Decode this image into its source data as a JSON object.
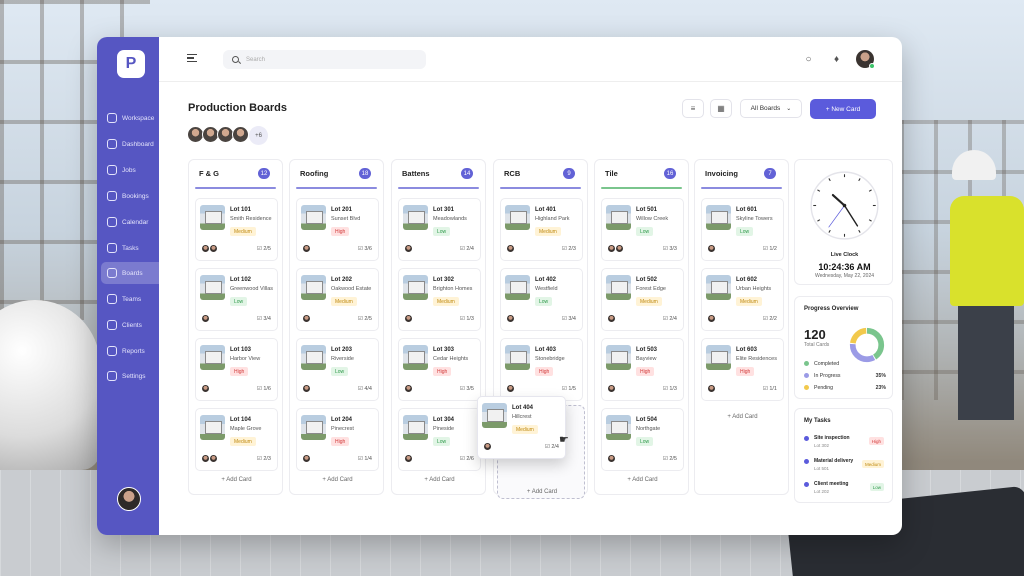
{
  "sidebar": {
    "items": [
      {
        "label": "Workspace"
      },
      {
        "label": "Dashboard"
      },
      {
        "label": "Jobs"
      },
      {
        "label": "Bookings"
      },
      {
        "label": "Calendar"
      },
      {
        "label": "Tasks"
      },
      {
        "label": "Boards"
      },
      {
        "label": "Teams"
      },
      {
        "label": "Clients"
      },
      {
        "label": "Reports"
      },
      {
        "label": "Settings"
      }
    ],
    "active": "Boards"
  },
  "topbar": {
    "search_placeholder": "Search"
  },
  "page": {
    "title": "Production Boards",
    "extra_members": "+6",
    "filter_label": "All Boards",
    "new_card_label": "+ New Card"
  },
  "columns": [
    {
      "name": "F & G",
      "count": "12",
      "color": "#8b8bdf",
      "cards": [
        {
          "lot": "Lot 101",
          "name": "Smith Residence",
          "priority": "Medium",
          "tasks": "2/5",
          "avatars": 2
        },
        {
          "lot": "Lot 102",
          "name": "Greenwood Villas",
          "priority": "Low",
          "tasks": "3/4",
          "avatars": 1
        },
        {
          "lot": "Lot 103",
          "name": "Harbor View",
          "priority": "High",
          "tasks": "1/6",
          "avatars": 1
        },
        {
          "lot": "Lot 104",
          "name": "Maple Grove",
          "priority": "Medium",
          "tasks": "2/3",
          "avatars": 2
        }
      ],
      "add": "+ Add Card"
    },
    {
      "name": "Roofing",
      "count": "18",
      "color": "#8b8bdf",
      "cards": [
        {
          "lot": "Lot 201",
          "name": "Sunset Blvd",
          "priority": "High",
          "tasks": "3/6",
          "avatars": 1
        },
        {
          "lot": "Lot 202",
          "name": "Oakwood Estate",
          "priority": "Medium",
          "tasks": "2/5",
          "avatars": 1
        },
        {
          "lot": "Lot 203",
          "name": "Riverside",
          "priority": "Low",
          "tasks": "4/4",
          "avatars": 1
        },
        {
          "lot": "Lot 204",
          "name": "Pinecrest",
          "priority": "High",
          "tasks": "1/4",
          "avatars": 1
        }
      ],
      "add": "+ Add Card"
    },
    {
      "name": "Battens",
      "count": "14",
      "color": "#8b8bdf",
      "cards": [
        {
          "lot": "Lot 301",
          "name": "Meadowlands",
          "priority": "Low",
          "tasks": "2/4",
          "avatars": 1
        },
        {
          "lot": "Lot 302",
          "name": "Brighton Homes",
          "priority": "Medium",
          "tasks": "1/3",
          "avatars": 1
        },
        {
          "lot": "Lot 303",
          "name": "Cedar Heights",
          "priority": "High",
          "tasks": "3/5",
          "avatars": 1
        },
        {
          "lot": "Lot 304",
          "name": "Pineside",
          "priority": "Low",
          "tasks": "2/6",
          "avatars": 1
        }
      ],
      "add": "+ Add Card"
    },
    {
      "name": "RCB",
      "count": "9",
      "color": "#8b8bdf",
      "cards": [
        {
          "lot": "Lot 401",
          "name": "Highland Park",
          "priority": "Medium",
          "tasks": "2/3",
          "avatars": 1
        },
        {
          "lot": "Lot 402",
          "name": "Westfield",
          "priority": "Low",
          "tasks": "3/4",
          "avatars": 1
        },
        {
          "lot": "Lot 403",
          "name": "Stonebridge",
          "priority": "High",
          "tasks": "1/5",
          "avatars": 1
        }
      ],
      "add": "+ Add Card",
      "dragging": {
        "lot": "Lot 404",
        "name": "Hillcrest",
        "priority": "Medium",
        "tasks": "2/4"
      }
    },
    {
      "name": "Tile",
      "count": "16",
      "color": "#7ac58d",
      "cards": [
        {
          "lot": "Lot 501",
          "name": "Willow Creek",
          "priority": "Low",
          "tasks": "3/3",
          "avatars": 2
        },
        {
          "lot": "Lot 502",
          "name": "Forest Edge",
          "priority": "Medium",
          "tasks": "2/4",
          "avatars": 1
        },
        {
          "lot": "Lot 503",
          "name": "Bayview",
          "priority": "High",
          "tasks": "1/3",
          "avatars": 1
        },
        {
          "lot": "Lot 504",
          "name": "Northgate",
          "priority": "Low",
          "tasks": "2/5",
          "avatars": 1
        }
      ],
      "add": "+ Add Card"
    },
    {
      "name": "Invoicing",
      "count": "7",
      "color": "#8b8bdf",
      "cards": [
        {
          "lot": "Lot 601",
          "name": "Skyline Towers",
          "priority": "Low",
          "tasks": "1/2",
          "avatars": 1
        },
        {
          "lot": "Lot 602",
          "name": "Urban Heights",
          "priority": "Medium",
          "tasks": "2/2",
          "avatars": 1
        },
        {
          "lot": "Lot 603",
          "name": "Elite Residences",
          "priority": "High",
          "tasks": "1/1",
          "avatars": 1
        }
      ],
      "add": "+ Add Card"
    }
  ],
  "clock": {
    "label": "Live Clock",
    "time": "10:24:36 AM",
    "date": "Wednesday, May 22, 2024",
    "hour": 10,
    "minute": 24,
    "second": 36
  },
  "progress": {
    "title": "Progress Overview",
    "total": "120",
    "total_label": "Total Cards",
    "items": [
      {
        "label": "Completed",
        "value": "",
        "color": "#7ac58d"
      },
      {
        "label": "In Progress",
        "value": "35%",
        "color": "#9b9be6"
      },
      {
        "label": "Pending",
        "value": "23%",
        "color": "#f2c94c"
      }
    ],
    "fractions": [
      0.42,
      0.35,
      0.23
    ]
  },
  "tasks": {
    "title": "My Tasks",
    "items": [
      {
        "name": "Site inspection",
        "lot": "Lot 302",
        "priority": "High"
      },
      {
        "name": "Material delivery",
        "lot": "Lot 501",
        "priority": "Medium"
      },
      {
        "name": "Client meeting",
        "lot": "Lot 202",
        "priority": "Low"
      }
    ]
  }
}
